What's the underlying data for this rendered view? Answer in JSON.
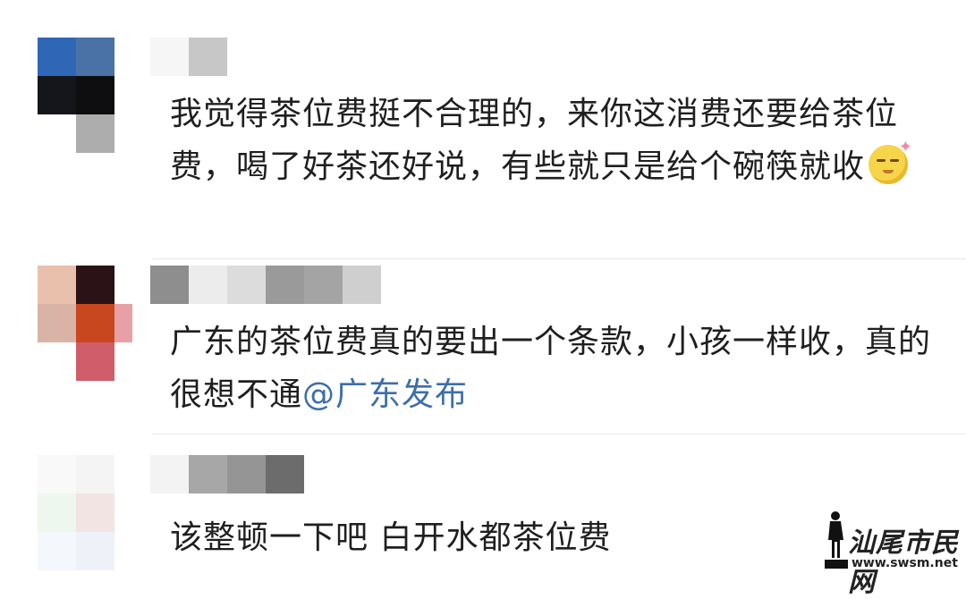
{
  "comments": [
    {
      "text": "我觉得茶位费挺不合理的，来你这消费还要给茶位费，喝了好茶还好说，有些就只是给个碗筷就收",
      "emoji": "smirk-emoji"
    },
    {
      "text": "广东的茶位费真的要出一个条款，小孩一样收，真的很想不通",
      "mention": "@广东发布"
    },
    {
      "text": "该整顿一下吧 白开水都茶位费"
    }
  ],
  "watermark": {
    "cn": "汕尾市民网",
    "url": "www.swsm.net"
  },
  "colors": {
    "mention": "#3d6ea9",
    "text": "#1f1f1f"
  }
}
